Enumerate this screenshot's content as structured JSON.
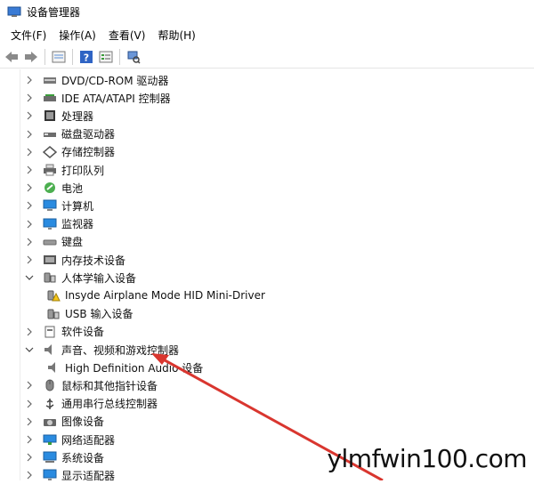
{
  "window": {
    "title": "设备管理器"
  },
  "menu": [
    {
      "label": "文件(F)"
    },
    {
      "label": "操作(A)"
    },
    {
      "label": "查看(V)"
    },
    {
      "label": "帮助(H)"
    }
  ],
  "tree": [
    {
      "label": "DVD/CD-ROM 驱动器",
      "icon": "dvd-drive-icon",
      "expanded": false,
      "level": 0
    },
    {
      "label": "IDE ATA/ATAPI 控制器",
      "icon": "ide-controller-icon",
      "expanded": false,
      "level": 0
    },
    {
      "label": "处理器",
      "icon": "processor-icon",
      "expanded": false,
      "level": 0
    },
    {
      "label": "磁盘驱动器",
      "icon": "disk-drive-icon",
      "expanded": false,
      "level": 0
    },
    {
      "label": "存储控制器",
      "icon": "storage-controller-icon",
      "expanded": false,
      "level": 0
    },
    {
      "label": "打印队列",
      "icon": "printer-icon",
      "expanded": false,
      "level": 0
    },
    {
      "label": "电池",
      "icon": "battery-icon",
      "expanded": false,
      "level": 0
    },
    {
      "label": "计算机",
      "icon": "computer-icon",
      "expanded": false,
      "level": 0
    },
    {
      "label": "监视器",
      "icon": "monitor-icon",
      "expanded": false,
      "level": 0
    },
    {
      "label": "键盘",
      "icon": "keyboard-icon",
      "expanded": false,
      "level": 0
    },
    {
      "label": "内存技术设备",
      "icon": "memory-device-icon",
      "expanded": false,
      "level": 0
    },
    {
      "label": "人体学输入设备",
      "icon": "hid-icon",
      "expanded": true,
      "level": 0
    },
    {
      "label": "Insyde Airplane Mode HID Mini-Driver",
      "icon": "hid-warning-icon",
      "level": 1
    },
    {
      "label": "USB 输入设备",
      "icon": "hid-device-icon",
      "level": 1
    },
    {
      "label": "软件设备",
      "icon": "software-device-icon",
      "expanded": false,
      "level": 0
    },
    {
      "label": "声音、视频和游戏控制器",
      "icon": "speaker-icon",
      "expanded": true,
      "level": 0
    },
    {
      "label": "High Definition Audio 设备",
      "icon": "audio-device-icon",
      "level": 1
    },
    {
      "label": "鼠标和其他指针设备",
      "icon": "mouse-icon",
      "expanded": false,
      "level": 0
    },
    {
      "label": "通用串行总线控制器",
      "icon": "usb-icon",
      "expanded": false,
      "level": 0
    },
    {
      "label": "图像设备",
      "icon": "camera-icon",
      "expanded": false,
      "level": 0
    },
    {
      "label": "网络适配器",
      "icon": "network-adapter-icon",
      "expanded": false,
      "level": 0
    },
    {
      "label": "系统设备",
      "icon": "system-device-icon",
      "expanded": false,
      "level": 0
    },
    {
      "label": "显示适配器",
      "icon": "display-adapter-icon",
      "expanded": false,
      "level": 0
    }
  ],
  "watermark": "ylmfwin100.com",
  "colors": {
    "annotation_arrow": "#d9362f"
  }
}
